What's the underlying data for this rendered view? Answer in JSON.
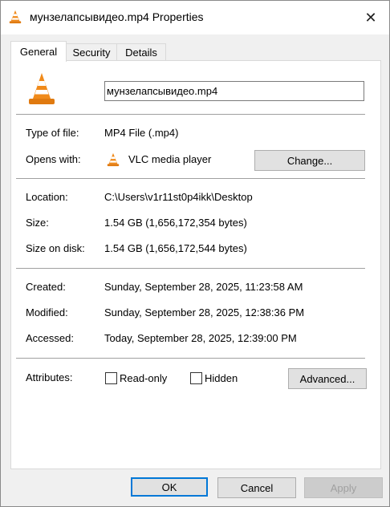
{
  "window": {
    "title": "мунзелапсывидео.mp4 Properties",
    "close_glyph": "✕"
  },
  "tabs": [
    {
      "label": "General",
      "active": true
    },
    {
      "label": "Security",
      "active": false
    },
    {
      "label": "Details",
      "active": false
    }
  ],
  "file": {
    "name": "мунзелапсывидео.mp4",
    "type_label": "Type of file:",
    "type_value": "MP4 File (.mp4)",
    "opens_label": "Opens with:",
    "opens_value": "VLC media player",
    "change_label": "Change...",
    "location_label": "Location:",
    "location_value": "C:\\Users\\v1r11st0p4ikk\\Desktop",
    "size_label": "Size:",
    "size_value": "1.54 GB (1,656,172,354 bytes)",
    "disk_label": "Size on disk:",
    "disk_value": "1.54 GB (1,656,172,544 bytes)",
    "created_label": "Created:",
    "created_value": "Sunday, September 28, 2025, 11:23:58 AM",
    "modified_label": "Modified:",
    "modified_value": "Sunday, September 28, 2025, 12:38:36 PM",
    "accessed_label": "Accessed:",
    "accessed_value": "Today, September 28, 2025, 12:39:00 PM",
    "attributes_label": "Attributes:",
    "readonly_label": "Read-only",
    "readonly_checked": false,
    "hidden_label": "Hidden",
    "hidden_checked": false,
    "advanced_label": "Advanced..."
  },
  "footer": {
    "ok_label": "OK",
    "cancel_label": "Cancel",
    "apply_label": "Apply"
  },
  "icons": {
    "file_icon": "vlc-cone-icon",
    "app_icon": "vlc-cone-icon"
  },
  "colors": {
    "vlc_orange": "#f08a1a",
    "focus_blue": "#0078d7",
    "disabled_text": "#a0a0a0"
  }
}
